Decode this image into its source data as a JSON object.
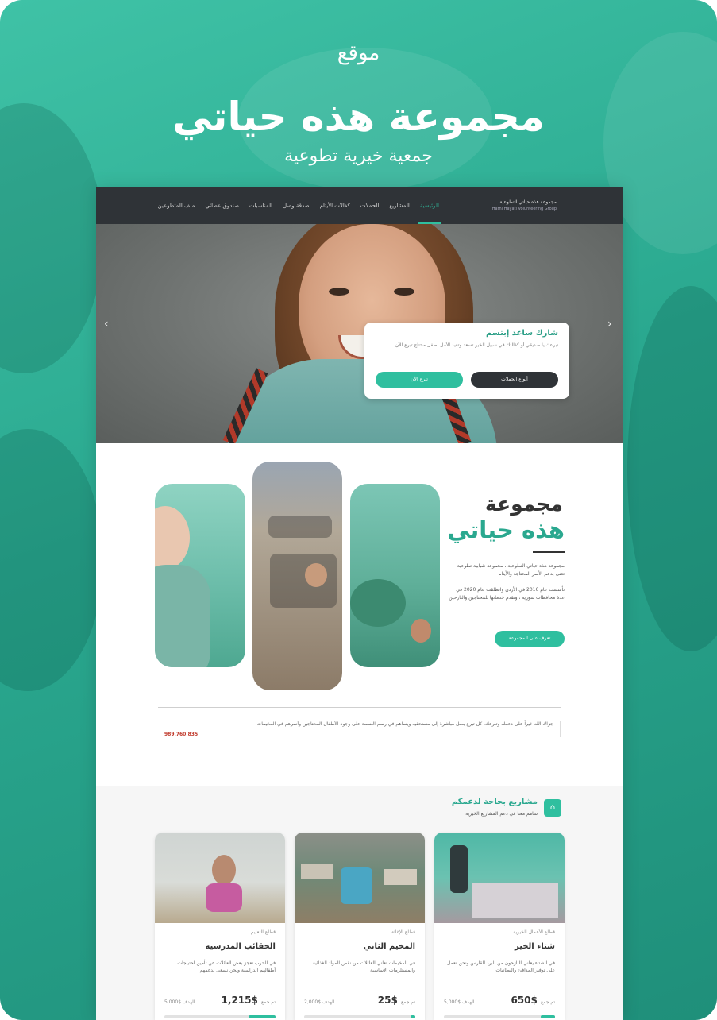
{
  "promo": {
    "tag": "موقع",
    "title": "مجموعة هذه حياتي",
    "subtitle": "جمعية خيرية تطوعية"
  },
  "nav": {
    "logo_ar": "مجموعة هذه حياتي التطوعية",
    "logo_en": "Hathi Hayati Volunteering Group",
    "items": [
      {
        "label": "الرئيسية",
        "active": true
      },
      {
        "label": "المشاريع"
      },
      {
        "label": "الحملات"
      },
      {
        "label": "كفالات الأيتام"
      },
      {
        "label": "صدقة وصل"
      },
      {
        "label": "المناسبات"
      },
      {
        "label": "صندوق عطائي"
      },
      {
        "label": "ملف المتطوعين"
      }
    ]
  },
  "hero": {
    "cta_title": "شارك ساعد إبتسم",
    "cta_text": "تبرعك يا صديقي أو كفالتك في سبيل الخير تسعد وتعيد الأمل لطفل محتاج تبرع الآن",
    "cta_primary": "تبرع الآن",
    "cta_secondary": "أنواع الحملات"
  },
  "about": {
    "title_line1": "مجموعة",
    "title_line2": "هذه حياتي",
    "p1": "مجموعة هذه حياتي التطوعية ، مجموعة شبابية تطوعية تعنى بدعم الأسر المحتاجة والأيتام",
    "p2": "تأسست عام 2016 في الأردن وانطلقت عام 2020 في عدة محافظات سورية ، وتقدم خدماتها للمحتاجين والنازحين",
    "button": "تعرف على المجموعة"
  },
  "quote": {
    "text": "جزاك الله خيراً على دعمك وتبرعك، كل تبرع يصل مباشرة إلى مستحقيه ويساهم في رسم البسمة على وجوه الأطفال المحتاجين وأسرهم في المخيمات",
    "number": "989,760,835"
  },
  "projects": {
    "title": "مشاريع بحاجة لدعمكم",
    "subtitle": "ساهم معنا في دعم المشاريع الخيرية"
  },
  "cards": [
    {
      "category": "قطاع التعليم",
      "title": "الحقائب المدرسية",
      "desc": "في الحرب تعجز بعض العائلات عن تأمين احتياجات أطفالهم الدراسية ونحن نسعى لدعمهم",
      "amount": "$1,215",
      "amount_label": "تم جمع",
      "goal": "الهدف $5,000",
      "progress": 0.24
    },
    {
      "category": "قطاع الإغاثة",
      "title": "المخيم الثاني",
      "desc": "في المخيمات تعاني العائلات من نقص المواد الغذائية والمستلزمات الأساسية",
      "amount": "$25",
      "amount_label": "تم جمع",
      "goal": "الهدف $2,000",
      "progress": 0.02
    },
    {
      "category": "قطاع الأعمال الخيرية",
      "title": "شتاء الخير",
      "desc": "في الشتاء يعاني النازحون من البرد القارس ونحن نعمل على توفير المدافئ والبطانيات",
      "amount": "$650",
      "amount_label": "تم جمع",
      "goal": "الهدف $5,000",
      "progress": 0.13
    }
  ],
  "colors": {
    "brand": "#2fbf9f",
    "dark": "#2f3337"
  }
}
